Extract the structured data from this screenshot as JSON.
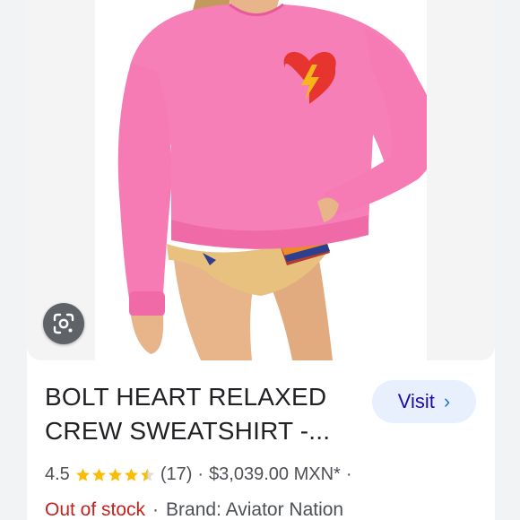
{
  "product": {
    "title_line1": "BOLT HEART RELAXED",
    "title_line2": "CREW SWEATSHIRT -...",
    "rating": "4.5",
    "review_count": "(17)",
    "price": "$3,039.00 MXN*",
    "separator": "·",
    "stock_status": "Out of stock",
    "brand": "Brand: Aviator Nation",
    "stars_filled": 4.5,
    "stars_total": 5
  },
  "actions": {
    "visit_label": "Visit",
    "visit_chevron": "›",
    "lens_icon": "google-lens-icon"
  },
  "colors": {
    "sweatshirt": "#f77fb8",
    "heart": "#e8342f",
    "bolt": "#f5b51b",
    "star": "#fbbc04",
    "out_of_stock": "#c5221f",
    "visit_bg": "#e8f0fe",
    "visit_text": "#1a0dab"
  }
}
